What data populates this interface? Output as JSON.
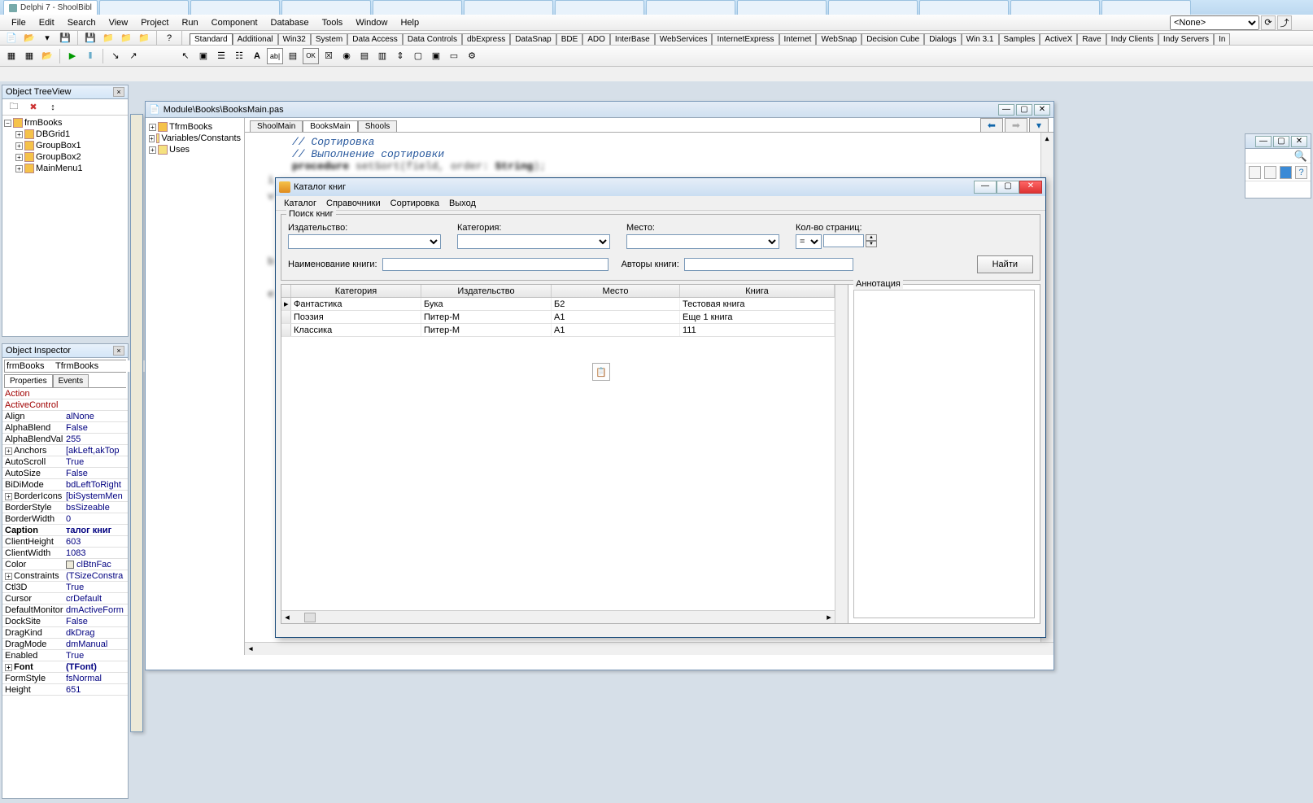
{
  "browser_tabs": [
    "Delphi 7 - ShoolBibl",
    "",
    "",
    "",
    "",
    "",
    "",
    "",
    "",
    "",
    "",
    "",
    "",
    ""
  ],
  "title": "Delphi 7 - ShoolBibl",
  "menu": [
    "File",
    "Edit",
    "Search",
    "View",
    "Project",
    "Run",
    "Component",
    "Database",
    "Tools",
    "Window",
    "Help"
  ],
  "combo_none": "<None>",
  "component_tabs": [
    "Standard",
    "Additional",
    "Win32",
    "System",
    "Data Access",
    "Data Controls",
    "dbExpress",
    "DataSnap",
    "BDE",
    "ADO",
    "InterBase",
    "WebServices",
    "InternetExpress",
    "Internet",
    "WebSnap",
    "Decision Cube",
    "Dialogs",
    "Win 3.1",
    "Samples",
    "ActiveX",
    "Rave",
    "Indy Clients",
    "Indy Servers",
    "In"
  ],
  "component_tabs_active": "Standard",
  "object_tree": {
    "title": "Object TreeView",
    "items": [
      {
        "label": "frmBooks",
        "icon": "form",
        "exp": "-"
      },
      {
        "label": "DBGrid1",
        "icon": "comp",
        "indent": 1,
        "exp": "+"
      },
      {
        "label": "GroupBox1",
        "icon": "comp",
        "indent": 1,
        "exp": "+"
      },
      {
        "label": "GroupBox2",
        "icon": "comp",
        "indent": 1,
        "exp": "+"
      },
      {
        "label": "MainMenu1",
        "icon": "comp",
        "indent": 1,
        "exp": "+"
      }
    ]
  },
  "structure_tree": [
    {
      "label": "TfrmBooks",
      "icon": "class",
      "exp": "+"
    },
    {
      "label": "Variables/Constants",
      "icon": "folder",
      "exp": "+"
    },
    {
      "label": "Uses",
      "icon": "folder",
      "exp": "+"
    }
  ],
  "object_inspector": {
    "title": "Object Inspector",
    "combo_left": "frmBooks",
    "combo_right": "TfrmBooks",
    "tabs": [
      "Properties",
      "Events"
    ],
    "active_tab": "Properties",
    "props": [
      {
        "n": "Action",
        "v": "",
        "red": true
      },
      {
        "n": "ActiveControl",
        "v": "",
        "red": true
      },
      {
        "n": "Align",
        "v": "alNone"
      },
      {
        "n": "AlphaBlend",
        "v": "False"
      },
      {
        "n": "AlphaBlendVal",
        "v": "255"
      },
      {
        "n": "Anchors",
        "v": "[akLeft,akTop",
        "exp": true
      },
      {
        "n": "AutoScroll",
        "v": "True"
      },
      {
        "n": "AutoSize",
        "v": "False"
      },
      {
        "n": "BiDiMode",
        "v": "bdLeftToRight"
      },
      {
        "n": "BorderIcons",
        "v": "[biSystemMen",
        "exp": true
      },
      {
        "n": "BorderStyle",
        "v": "bsSizeable"
      },
      {
        "n": "BorderWidth",
        "v": "0"
      },
      {
        "n": "Caption",
        "v": "талог книг",
        "bold": true
      },
      {
        "n": "ClientHeight",
        "v": "603"
      },
      {
        "n": "ClientWidth",
        "v": "1083"
      },
      {
        "n": "Color",
        "v": "clBtnFac",
        "colorbox": true
      },
      {
        "n": "Constraints",
        "v": "(TSizeConstra",
        "exp": true
      },
      {
        "n": "Ctl3D",
        "v": "True"
      },
      {
        "n": "Cursor",
        "v": "crDefault"
      },
      {
        "n": "DefaultMonitor",
        "v": "dmActiveForm"
      },
      {
        "n": "DockSite",
        "v": "False"
      },
      {
        "n": "DragKind",
        "v": "dkDrag"
      },
      {
        "n": "DragMode",
        "v": "dmManual"
      },
      {
        "n": "Enabled",
        "v": "True"
      },
      {
        "n": "Font",
        "v": "(TFont)",
        "exp": true,
        "bold": true
      },
      {
        "n": "FormStyle",
        "v": "fsNormal"
      },
      {
        "n": "Height",
        "v": "651"
      }
    ]
  },
  "editor": {
    "path": "Module\\Books\\BooksMain.pas",
    "tabs": [
      "ShoolMain",
      "BooksMain",
      "Shools"
    ],
    "active_tab": "BooksMain",
    "code_lines": [
      {
        "text": "// Сортировка",
        "type": "comment"
      },
      {
        "text": "// Выполнение сортировки",
        "type": "comment"
      },
      {
        "text": "procedure setSort(field, order: String);",
        "type": "blur"
      }
    ]
  },
  "app": {
    "title": "Каталог книг",
    "menu": [
      "Каталог",
      "Справочники",
      "Сортировка",
      "Выход"
    ],
    "search_group": "Поиск книг",
    "labels": {
      "publisher": "Издательство:",
      "category": "Категория:",
      "place": "Место:",
      "pages": "Кол-во страниц:",
      "bookname": "Наименование книги:",
      "authors": "Авторы книги:"
    },
    "pages_op": "=",
    "find_btn": "Найти",
    "grid": {
      "headers": [
        "Категория",
        "Издательство",
        "Место",
        "Книга"
      ],
      "rows": [
        [
          "Фантастика",
          "Бука",
          "Б2",
          "Тестовая книга"
        ],
        [
          "Поэзия",
          "Питер-М",
          "А1",
          "Еще 1 книга"
        ],
        [
          "Классика",
          "Питер-М",
          "А1",
          "111"
        ]
      ]
    },
    "annotation": "Аннотация"
  }
}
